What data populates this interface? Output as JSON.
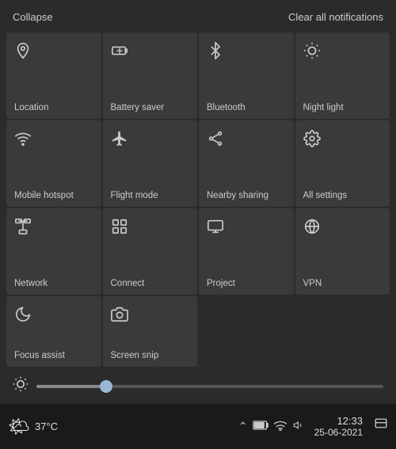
{
  "header": {
    "collapse_label": "Collapse",
    "clear_label": "Clear all notifications"
  },
  "tiles": [
    {
      "id": "location",
      "label": "Location",
      "icon": "location",
      "active": false
    },
    {
      "id": "battery-saver",
      "label": "Battery saver",
      "icon": "battery",
      "active": false
    },
    {
      "id": "bluetooth",
      "label": "Bluetooth",
      "icon": "bluetooth",
      "active": false
    },
    {
      "id": "night-light",
      "label": "Night light",
      "icon": "night-light",
      "active": false
    },
    {
      "id": "mobile-hotspot",
      "label": "Mobile hotspot",
      "icon": "hotspot",
      "active": false
    },
    {
      "id": "flight-mode",
      "label": "Flight mode",
      "icon": "plane",
      "active": false
    },
    {
      "id": "nearby-sharing",
      "label": "Nearby sharing",
      "icon": "share",
      "active": false
    },
    {
      "id": "all-settings",
      "label": "All settings",
      "icon": "settings",
      "active": false
    },
    {
      "id": "network",
      "label": "Network",
      "icon": "network",
      "active": false
    },
    {
      "id": "connect",
      "label": "Connect",
      "icon": "connect",
      "active": false
    },
    {
      "id": "project",
      "label": "Project",
      "icon": "project",
      "active": false
    },
    {
      "id": "vpn",
      "label": "VPN",
      "icon": "vpn",
      "active": false
    },
    {
      "id": "focus-assist",
      "label": "Focus assist",
      "icon": "moon",
      "active": false
    },
    {
      "id": "screen-snip",
      "label": "Screen snip",
      "icon": "snip",
      "active": false
    }
  ],
  "brightness": {
    "value": 20
  },
  "taskbar": {
    "weather_icon": "🌤",
    "temperature": "37°C",
    "time": "12:33",
    "date": "25-06-2021"
  }
}
